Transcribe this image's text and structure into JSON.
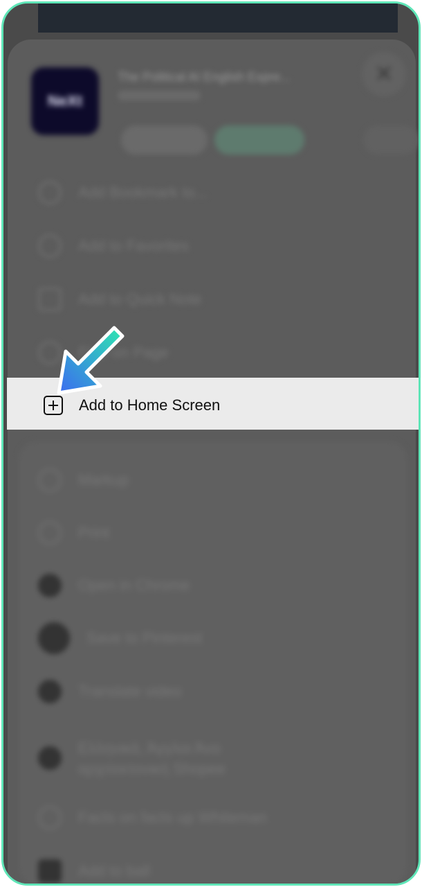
{
  "sheet": {
    "app_icon_text": "NeXt",
    "page_title": "The Political AI English Expre...",
    "close_glyph": "✕"
  },
  "menu": {
    "group1": [
      {
        "label": "Add Bookmark to...",
        "icon": "book-icon"
      },
      {
        "label": "Add to Favorites",
        "icon": "star-icon"
      },
      {
        "label": "Add to Quick Note",
        "icon": "quick-note-icon"
      },
      {
        "label": "Find on Page",
        "icon": "find-icon"
      }
    ],
    "highlighted": {
      "label": "Add to Home Screen",
      "icon": "plus-square-icon"
    },
    "group2": [
      {
        "label": "Markup",
        "icon": "markup-icon"
      },
      {
        "label": "Print",
        "icon": "print-icon"
      },
      {
        "label": "Open in Chrome",
        "icon": "chrome-icon"
      },
      {
        "label": "Save to Pinterest",
        "icon": "pinterest-icon"
      },
      {
        "label": "Translate video",
        "icon": "translate-icon"
      },
      {
        "label": "Ελληνικά, Άγγλοι Άνο",
        "label2": "αρχιτεκτονική Shopee",
        "icon": "app-icon"
      },
      {
        "label": "Facts on facts up Whiteman",
        "icon": "facts-icon"
      },
      {
        "label": "Add to ball",
        "icon": "ball-icon"
      }
    ]
  },
  "colors": {
    "accent_border": "#5fe6b8",
    "arrow_start": "#2ee6b0",
    "arrow_end": "#3b6cf0"
  }
}
